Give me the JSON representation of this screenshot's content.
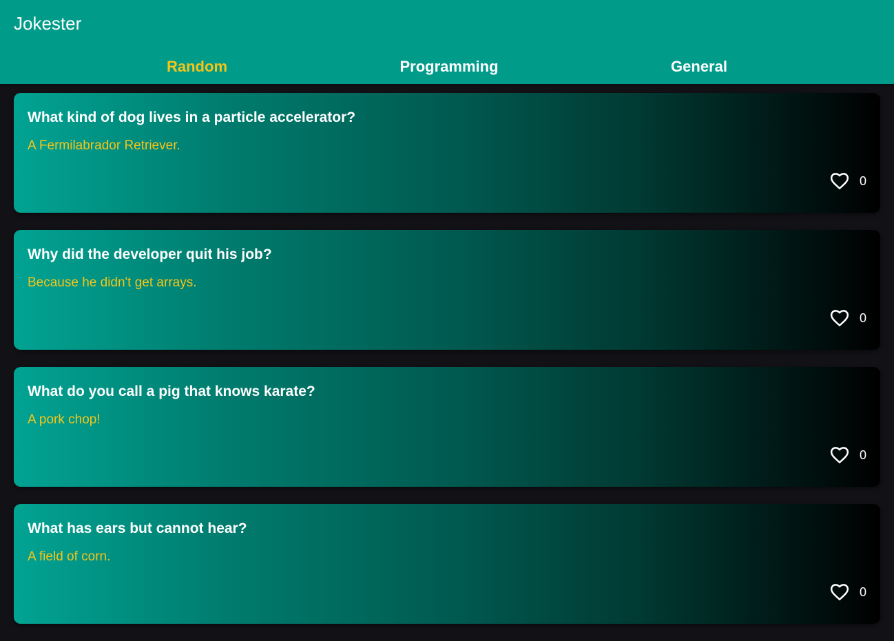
{
  "app": {
    "title": "Jokester"
  },
  "tabs": [
    {
      "label": "Random",
      "active": true
    },
    {
      "label": "Programming",
      "active": false
    },
    {
      "label": "General",
      "active": false
    }
  ],
  "jokes": [
    {
      "setup": "What kind of dog lives in a particle accelerator?",
      "punchline": "A Fermilabrador Retriever.",
      "likes": "0"
    },
    {
      "setup": "Why did the developer quit his job?",
      "punchline": "Because he didn't get arrays.",
      "likes": "0"
    },
    {
      "setup": "What do you call a pig that knows karate?",
      "punchline": "A pork chop!",
      "likes": "0"
    },
    {
      "setup": "What has ears but cannot hear?",
      "punchline": "A field of corn.",
      "likes": "0"
    }
  ],
  "colors": {
    "appbar": "#019b8a",
    "accent": "#f5c518",
    "background": "#121116"
  },
  "icons": {
    "like": "heart-outline-icon"
  }
}
